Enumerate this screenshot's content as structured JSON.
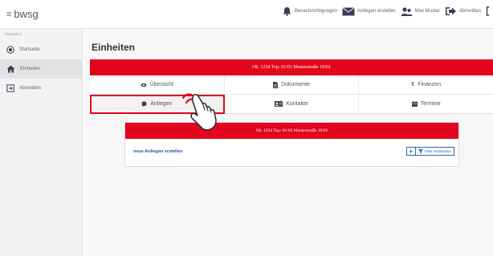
{
  "header": {
    "brand": "bwsg",
    "nav": [
      {
        "icon": "bell-icon",
        "label": "Benachrichtigungen"
      },
      {
        "icon": "envelope-icon",
        "label": "Anliegen erstellen"
      },
      {
        "icon": "users-icon",
        "label": "Max Muster"
      },
      {
        "icon": "logout-icon",
        "label": "Abmelden"
      }
    ]
  },
  "sidebar": {
    "caption": "Navigation",
    "items": [
      {
        "label": "Startseite",
        "icon": "dashboard-icon"
      },
      {
        "label": "Einheiten",
        "icon": "home-icon"
      },
      {
        "label": "Abmelden",
        "icon": "logout-icon"
      }
    ]
  },
  "main": {
    "title": "Einheiten",
    "unit_bar": "Ob. 1234 Top: 01/03 Musterstraße 10/01",
    "tabs": [
      {
        "label": "Übersicht",
        "icon": "eye-icon"
      },
      {
        "label": "Dokumente",
        "icon": "file-icon"
      },
      {
        "label": "Finanzen",
        "icon": "euro-icon"
      },
      {
        "label": "Anliegen",
        "icon": "comment-icon"
      },
      {
        "label": "Kontakte",
        "icon": "contact-card-icon"
      },
      {
        "label": "Termine",
        "icon": "calendar-icon"
      }
    ],
    "subpanel": {
      "bar": "Ob. 1234 Top: 01/03 Musterstraße 10/01",
      "new_link": "neue Anliegen erstellen",
      "plus_label": "+",
      "filter_label": "Filter einblenden"
    }
  },
  "colors": {
    "accent": "#e3051b",
    "link": "#1a5aa6"
  }
}
